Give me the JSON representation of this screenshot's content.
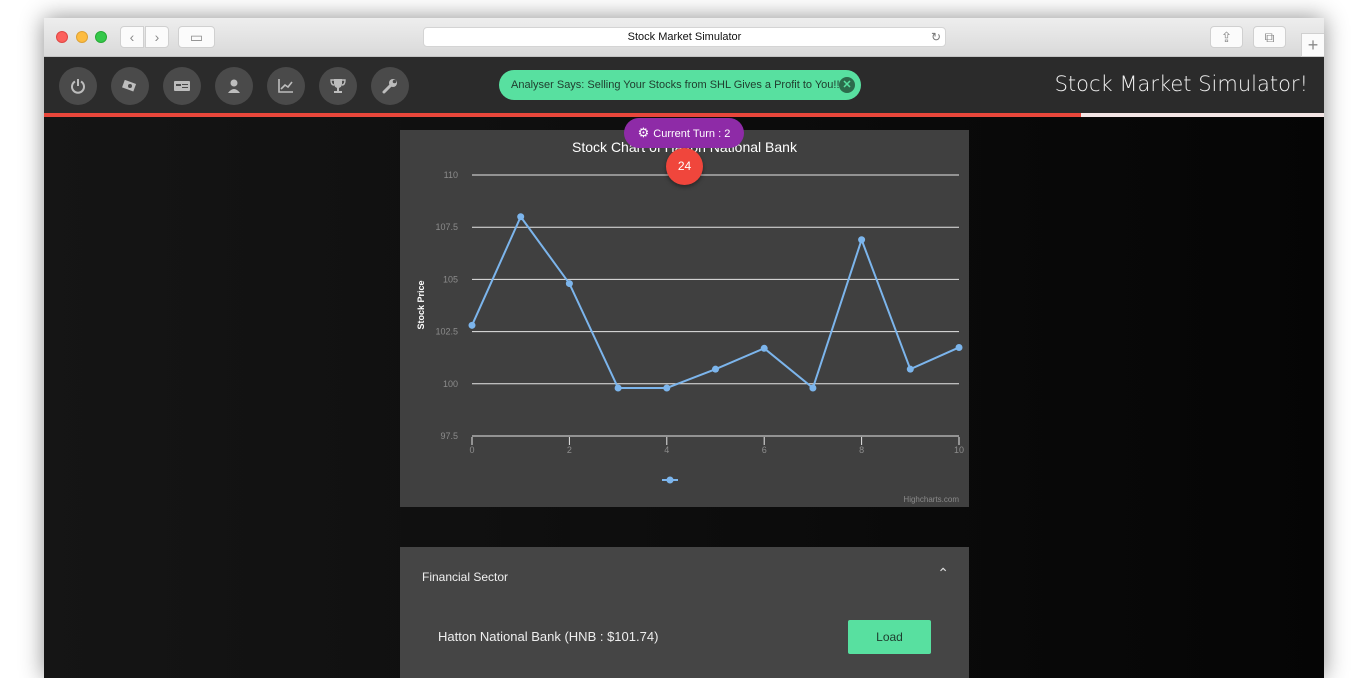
{
  "browser": {
    "title": "Stock Market Simulator",
    "back_label": "‹",
    "forward_label": "›",
    "sidebar_label": "▭",
    "share_label": "⇪",
    "tabs_label": "⧉",
    "newtab_label": "+",
    "reload_label": "↻"
  },
  "toolbar": {
    "icons": [
      "power-icon",
      "money-icon",
      "card-icon",
      "user-icon",
      "chart-icon",
      "trophy-icon",
      "wrench-icon"
    ]
  },
  "toast": {
    "message": "Analyser Says: Selling Your Stocks from SHL Gives a Profit to You!!",
    "close_label": "✕"
  },
  "app_title": "Stock Market Simulator!",
  "game_progress": 0.81,
  "turn": {
    "label": "Current Turn : 2"
  },
  "timer": {
    "value": "24"
  },
  "chart_data": {
    "type": "line",
    "title": "Stock Chart of Hatton National Bank",
    "xlabel": "",
    "ylabel": "Stock Price",
    "x": [
      0,
      1,
      2,
      3,
      4,
      5,
      6,
      7,
      8,
      9,
      10
    ],
    "series": [
      {
        "values": [
          102.8,
          108.0,
          104.8,
          99.8,
          99.8,
          100.7,
          101.7,
          99.8,
          106.9,
          100.7,
          101.74
        ],
        "color": "#7cb5ec"
      }
    ],
    "ylim": [
      97.5,
      110
    ],
    "yticks": [
      "97.5",
      "100",
      "102.5",
      "105",
      "107.5",
      "110"
    ],
    "xticks": [
      "0",
      "2",
      "4",
      "6",
      "8",
      "10"
    ],
    "credit": "Highcharts.com",
    "grid": true,
    "legend": "bottom-center"
  },
  "sector": {
    "title": "Financial Sector",
    "chevron": "⌃",
    "stock_label": "Hatton National Bank (HNB : $101.74)",
    "load_label": "Load"
  },
  "colors": {
    "accent_green": "#58e0a0",
    "accent_red": "#e9473b",
    "turn_purple": "#8e2ba7",
    "series_blue": "#7cb5ec"
  }
}
